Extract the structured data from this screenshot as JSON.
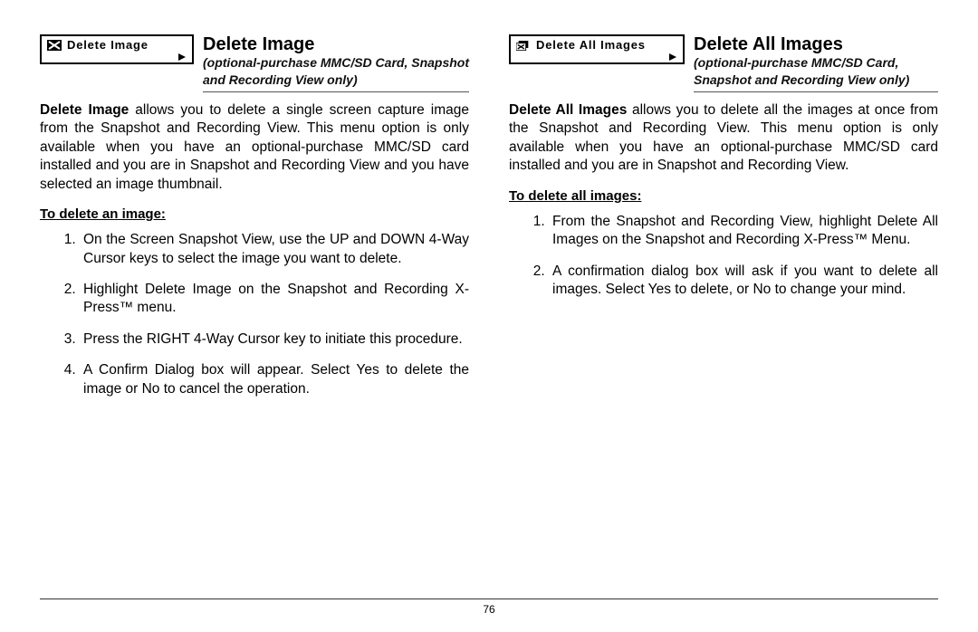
{
  "page_number": "76",
  "left": {
    "menu_label": "Delete Image",
    "title": "Delete Image",
    "subtitle": "(optional-purchase MMC/SD Card, Snapshot and Recording View only)",
    "lead": "Delete Image",
    "body": " allows you to delete a single screen capture image from the Snapshot and Recording View. This menu option is only available when you have an optional-purchase MMC/SD card installed and you are in Snapshot and Recording View and you have selected an image thumbnail.",
    "subhead": "To delete an image:",
    "steps": [
      "On the Screen Snapshot View, use the UP and DOWN 4-Way Cursor keys to select the image you want to delete.",
      "Highlight Delete Image on the Snapshot and Recording X-Press™ menu.",
      "Press the RIGHT 4-Way Cursor key to initiate this procedure.",
      "A Confirm Dialog box will appear. Select Yes to delete the image or No to cancel the operation."
    ]
  },
  "right": {
    "menu_label": "Delete All Images",
    "title": "Delete All Images",
    "subtitle": "(optional-purchase MMC/SD Card, Snapshot and Recording View only)",
    "lead": "Delete All Images",
    "body": " allows you to delete all the images at once from the Snapshot and Recording View. This menu option is only available when you have an optional-purchase MMC/SD card installed and you are in Snapshot and Recording View.",
    "subhead": "To delete all images:",
    "steps": [
      "From the Snapshot and Recording View, highlight Delete All Images on the Snapshot and Recording X-Press™ Menu.",
      "A confirmation dialog box will ask if you want to delete all images. Select Yes to delete, or No to change your mind."
    ]
  }
}
